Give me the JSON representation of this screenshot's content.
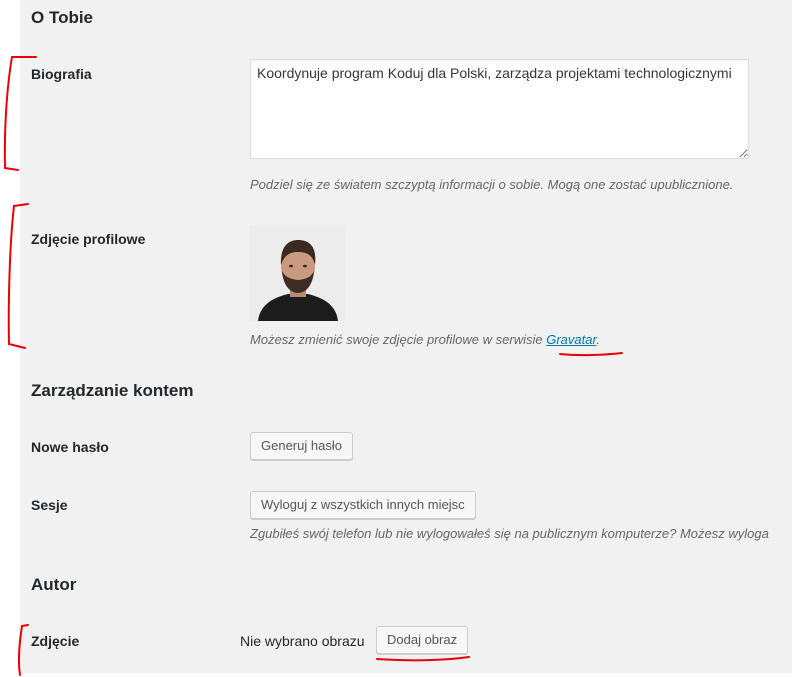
{
  "about": {
    "heading": "O Tobie",
    "bio_label": "Biografia",
    "bio_value": "Koordynuje program Koduj dla Polski, zarządza projektami technologicznymi",
    "bio_desc": "Podziel się ze światem szczyptą informacji o sobie. Mogą one zostać upublicznione.",
    "photo_label": "Zdjęcie profilowe",
    "photo_desc_before": "Możesz zmienić swoje zdjęcie profilowe w serwisie ",
    "photo_desc_link": "Gravatar",
    "photo_desc_after": "."
  },
  "account": {
    "heading": "Zarządzanie kontem",
    "password_label": "Nowe hasło",
    "password_button": "Generuj hasło",
    "sessions_label": "Sesje",
    "sessions_button": "Wyloguj z wszystkich innych miejsc",
    "sessions_desc": "Zgubiłeś swój telefon lub nie wylogowałeś się na publicznym komputerze? Możesz wyloga"
  },
  "author": {
    "heading": "Autor",
    "photo_label": "Zdjęcie",
    "no_image": "Nie wybrano obrazu",
    "add_image_button": "Dodaj obraz"
  },
  "colors": {
    "panel_bg": "#f1f1f1",
    "link": "#0073aa",
    "annotation": "#e8000b"
  }
}
